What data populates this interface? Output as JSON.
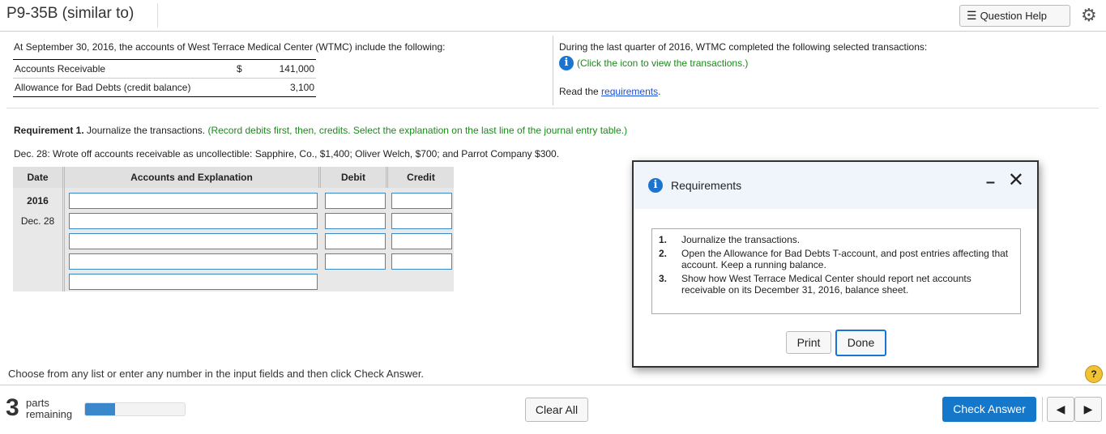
{
  "header": {
    "title": "P9-35B (similar to)",
    "help_label": "Question Help"
  },
  "left": {
    "intro": "At September 30, 2016, the accounts of West Terrace Medical Center (WTMC) include the following:",
    "accounts": [
      {
        "name": "Accounts Receivable",
        "currency": "$",
        "amount": "141,000"
      },
      {
        "name": "Allowance for Bad Debts (credit balance)",
        "currency": "",
        "amount": "3,100"
      }
    ]
  },
  "right": {
    "intro": "During the last quarter of 2016, WTMC completed the following selected transactions:",
    "icon_link": "(Click the icon to view the transactions.)",
    "read_prefix": "Read the ",
    "read_link": "requirements",
    "read_suffix": "."
  },
  "requirement": {
    "label": "Requirement 1.",
    "text": " Journalize the transactions. ",
    "hint": "(Record debits first, then, credits. Select the explanation on the last line of the journal entry table.)",
    "transaction": "Dec. 28: Wrote off accounts receivable as uncollectible: Sapphire, Co., $1,400; Oliver Welch, $700; and Parrot Company $300."
  },
  "journal": {
    "headers": [
      "Date",
      "Accounts and Explanation",
      "Debit",
      "Credit"
    ],
    "year": "2016",
    "date": "Dec. 28"
  },
  "modal": {
    "title": "Requirements",
    "items": [
      {
        "n": "1.",
        "t": "Journalize the transactions."
      },
      {
        "n": "2.",
        "t": "Open the Allowance for Bad Debts T-account, and post entries affecting that account. Keep a running balance."
      },
      {
        "n": "3.",
        "t": "Show how West Terrace Medical Center should report net accounts receivable on its December 31, 2016, balance sheet."
      }
    ],
    "print": "Print",
    "done": "Done"
  },
  "footer": {
    "instruction": "Choose from any list or enter any number in the input fields and then click Check Answer.",
    "parts_count": "3",
    "parts_label1": "parts",
    "parts_label2": "remaining",
    "progress_percent": 30,
    "clear_all": "Clear All",
    "check_answer": "Check Answer"
  },
  "colors": {
    "accent": "#1b75d0",
    "hint": "#1a8a1a"
  }
}
